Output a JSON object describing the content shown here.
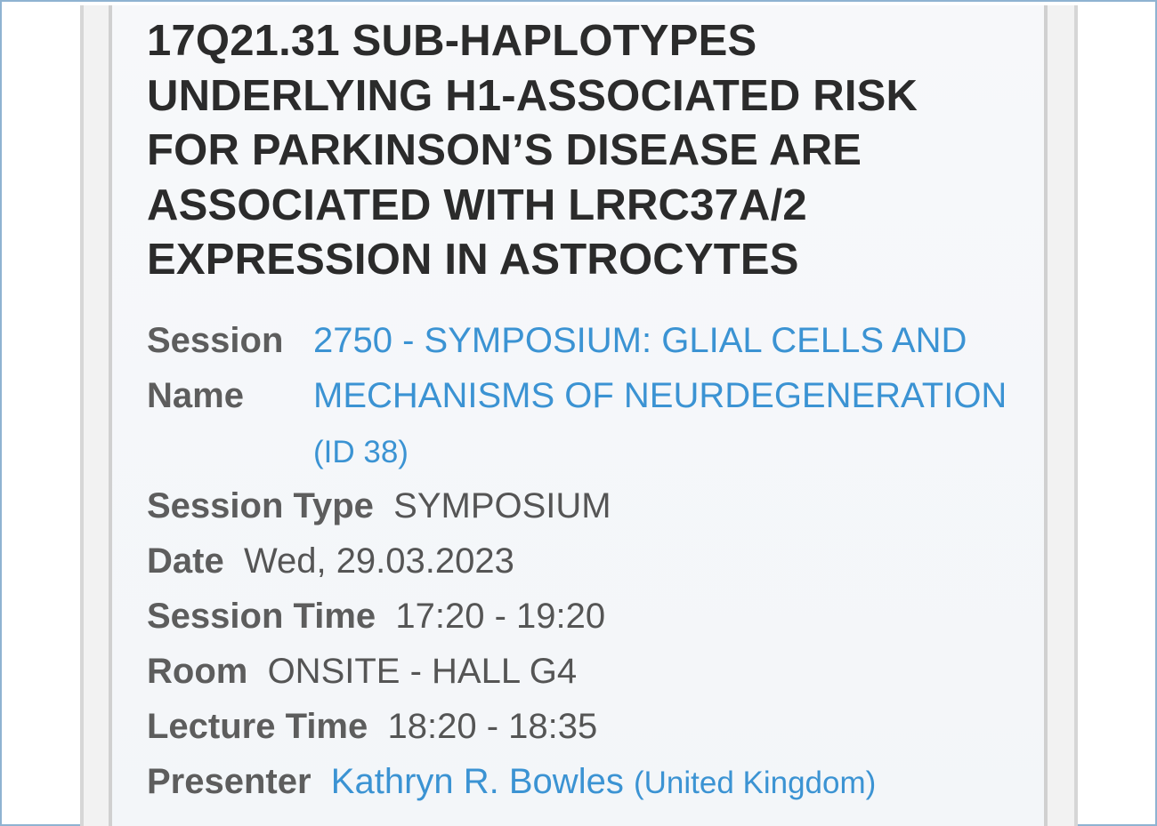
{
  "title": "17Q21.31 SUB-HAPLOTYPES UNDERLYING H1-ASSOCIATED RISK FOR PARKINSON’S DISEASE ARE ASSOCIATED WITH LRRC37A/2 EXPRESSION IN ASTROCYTES",
  "title_lines": [
    "17Q21.31 SUB-HAPLOTYPES",
    "UNDERLYING H1-ASSOCIATED RISK",
    "FOR PARKINSON’S DISEASE ARE",
    "ASSOCIATED WITH LRRC37A/2",
    "EXPRESSION IN ASTROCYTES"
  ],
  "session_name": {
    "label_line1": "Session",
    "label_line2": "Name",
    "link_text": "2750 - SYMPOSIUM: GLIAL CELLS AND MECHANISMS OF NEURDEGENERATION",
    "id_text": "(ID 38)"
  },
  "session_type": {
    "label": "Session Type",
    "value": "SYMPOSIUM"
  },
  "date": {
    "label": "Date",
    "value": "Wed, 29.03.2023"
  },
  "session_time": {
    "label": "Session Time",
    "value": "17:20 - 19:20"
  },
  "room": {
    "label": "Room",
    "value": "ONSITE - HALL G4"
  },
  "lecture_time": {
    "label": "Lecture Time",
    "value": "18:20 - 18:35"
  },
  "presenter": {
    "label": "Presenter",
    "name": "Kathryn R. Bowles",
    "country": "(United Kingdom)"
  },
  "colors": {
    "title": "#2b2b2b",
    "label": "#5d5d5d",
    "value": "#555555",
    "link": "#3b93d3",
    "frame": "#8fb3d1"
  }
}
